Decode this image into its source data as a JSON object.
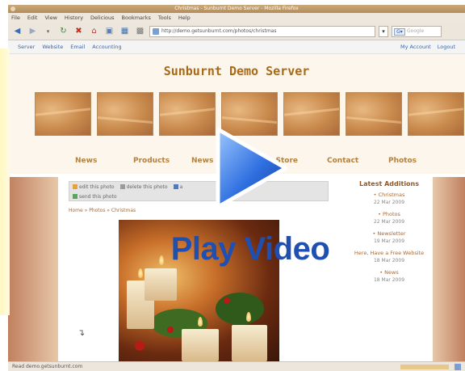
{
  "browser": {
    "title": "Christmas - Sunburnt Demo Server - Mozilla Firefox",
    "menu": [
      "File",
      "Edit",
      "View",
      "History",
      "Delicious",
      "Bookmarks",
      "Tools",
      "Help"
    ],
    "url": "http://demo.getsunburnt.com/photos/christmas",
    "search_placeholder": "Google",
    "status": "Read demo.getsunburnt.com"
  },
  "site": {
    "title": "Sunburnt Demo Server",
    "topnav_left": [
      "Server",
      "Website",
      "Email",
      "Accounting"
    ],
    "topnav_right": [
      "My Account",
      "Logout"
    ],
    "nav": [
      "News",
      "Products",
      "News",
      "Store",
      "Contact",
      "Photos"
    ]
  },
  "page": {
    "actions": [
      "edit this photo",
      "delete this photo",
      "a",
      "send this photo"
    ],
    "breadcrumb": "Home » Photos » Christmas",
    "sidebar_title": "Latest Additions",
    "additions": [
      {
        "label": "Christmas",
        "date": "22 Mar 2009"
      },
      {
        "label": "Photos",
        "date": "22 Mar 2009"
      },
      {
        "label": "Newsletter",
        "date": "19 Mar 2009"
      },
      {
        "label": "Here, Have a Free Website",
        "date": "18 Mar 2009"
      },
      {
        "label": "News",
        "date": "18 Mar 2009"
      }
    ]
  },
  "overlay": {
    "play_label": "Play Video"
  },
  "colors": {
    "accent": "#1f4fb0",
    "title_brown": "#a86a18",
    "link": "#3a66a8"
  }
}
